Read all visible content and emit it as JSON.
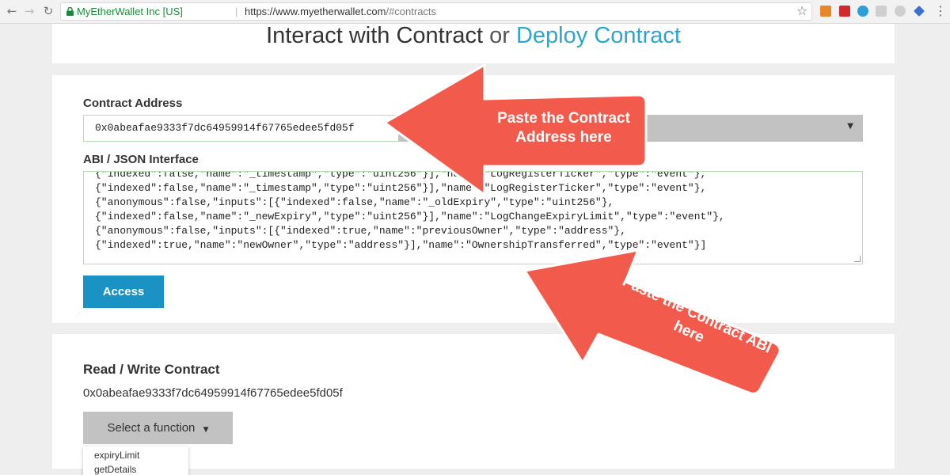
{
  "browser": {
    "secure_label": "MyEtherWallet Inc [US]",
    "separator": "|",
    "url_host": "https://www.myetherwallet.com",
    "url_path": "/#contracts"
  },
  "page": {
    "heading_main": "Interact with Contract",
    "heading_or": "or",
    "heading_link": "Deploy Contract"
  },
  "form": {
    "contract_address_label": "Contract Address",
    "contract_address_value": "0x0abeafae9333f7dc64959914f67765edee5fd05f",
    "abi_label": "ABI / JSON Interface",
    "abi_lines": [
      "{\"indexed\":false,\"name\":\"_timestamp\",\"type\":\"uint256\"}],\"name\":\"LogRegisterTicker\",\"type\":\"event\"},",
      "{\"anonymous\":false,\"inputs\":[{\"indexed\":false,\"name\":\"_oldExpiry\",\"type\":\"uint256\"},",
      "{\"indexed\":false,\"name\":\"_newExpiry\",\"type\":\"uint256\"}],\"name\":\"LogChangeExpiryLimit\",\"type\":\"event\"},",
      "{\"anonymous\":false,\"inputs\":[{\"indexed\":true,\"name\":\"previousOwner\",\"type\":\"address\"},",
      "{\"indexed\":true,\"name\":\"newOwner\",\"type\":\"address\"}],\"name\":\"OwnershipTransferred\",\"type\":\"event\"}]"
    ],
    "access_button": "Access"
  },
  "read_write": {
    "title": "Read / Write Contract",
    "address": "0x0abeafae9333f7dc64959914f67765edee5fd05f",
    "select_label": "Select a function",
    "functions": [
      "expiryLimit",
      "getDetails"
    ]
  },
  "annotations": {
    "address_note": "Paste the Contract Address here",
    "abi_note": "Paste the Contract ABI here",
    "arrow_color": "#f25a4c"
  },
  "colors": {
    "accent": "#1a93c4",
    "link": "#2fa4cf",
    "valid_border": "#b3dfae"
  }
}
